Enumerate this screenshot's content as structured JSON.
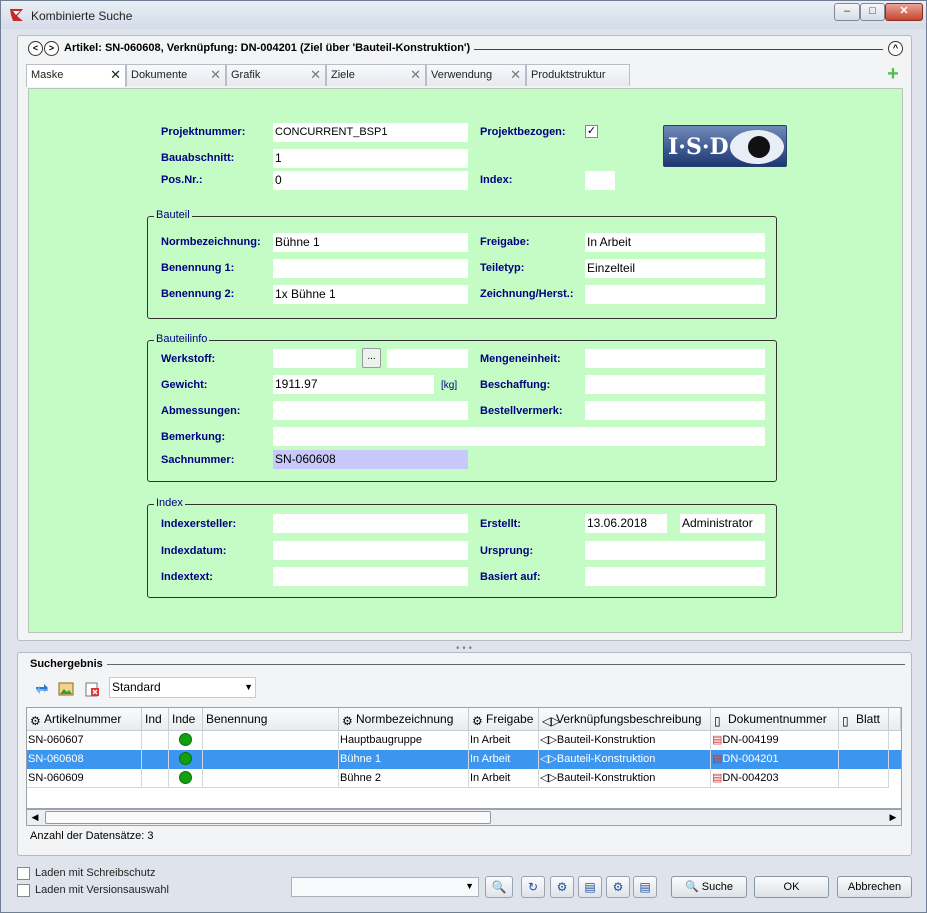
{
  "window": {
    "title": "Kombinierte Suche",
    "minimize": "‒",
    "maximize": "□",
    "close": "✕"
  },
  "header": {
    "back": "<",
    "forward": ">",
    "collapse": "^",
    "title": "Artikel: SN-060608, Verknüpfung: DN-004201 (Ziel über 'Bauteil-Konstruktion')"
  },
  "tabs": [
    {
      "label": "Maske",
      "close": "✕"
    },
    {
      "label": "Dokumente",
      "close": "✕"
    },
    {
      "label": "Grafik",
      "close": "✕"
    },
    {
      "label": "Ziele",
      "close": "✕"
    },
    {
      "label": "Verwendung",
      "close": "✕"
    },
    {
      "label": "Produktstruktur",
      "close": ""
    }
  ],
  "add_tab": "+",
  "form": {
    "projektnummer_label": "Projektnummer:",
    "projektnummer_value": "CONCURRENT_BSP1",
    "projektbezogen_label": "Projektbezogen:",
    "projektbezogen_check": "✓",
    "bauabschnitt_label": "Bauabschnitt:",
    "bauabschnitt_value": "1",
    "posnr_label": "Pos.Nr.:",
    "posnr_value": "0",
    "index_label": "Index:",
    "index_value": "",
    "logo_text": "I·S·D",
    "bauteil": {
      "title": "Bauteil",
      "normbezeichnung_label": "Normbezeichnung:",
      "normbezeichnung_value": "Bühne 1",
      "freigabe_label": "Freigabe:",
      "freigabe_value": "In Arbeit",
      "benennung1_label": "Benennung 1:",
      "benennung1_value": "",
      "teiletyp_label": "Teiletyp:",
      "teiletyp_value": "Einzelteil",
      "benennung2_label": "Benennung 2:",
      "benennung2_value": "1x Bühne 1",
      "zeichnung_label": "Zeichnung/Herst.:",
      "zeichnung_value": ""
    },
    "bauteilinfo": {
      "title": "Bauteilinfo",
      "werkstoff_label": "Werkstoff:",
      "werkstoff_value": "",
      "werkstoff_button": "...",
      "werkstoff_value2": "",
      "mengeneinheit_label": "Mengeneinheit:",
      "mengeneinheit_value": "",
      "gewicht_label": "Gewicht:",
      "gewicht_value": "1911.97",
      "gewicht_unit": "[kg]",
      "beschaffung_label": "Beschaffung:",
      "beschaffung_value": "",
      "abmessungen_label": "Abmessungen:",
      "abmessungen_value": "",
      "bestellvermerk_label": "Bestellvermerk:",
      "bestellvermerk_value": "",
      "bemerkung_label": "Bemerkung:",
      "bemerkung_value": "",
      "sachnummer_label": "Sachnummer:",
      "sachnummer_value": "SN-060608"
    },
    "index_group": {
      "title": "Index",
      "indexersteller_label": "Indexersteller:",
      "indexersteller_value": "",
      "erstellt_label": "Erstellt:",
      "erstellt_date": "13.06.2018",
      "erstellt_user": "Administrator",
      "indexdatum_label": "Indexdatum:",
      "indexdatum_value": "",
      "ursprung_label": "Ursprung:",
      "ursprung_value": "",
      "indextext_label": "Indextext:",
      "indextext_value": "",
      "basiert_label": "Basiert auf:",
      "basiert_value": ""
    }
  },
  "splitter": "• • •",
  "results": {
    "title": "Suchergebnis",
    "view_combo": "Standard",
    "columns": [
      "Artikelnummer",
      "Ind",
      "Inde",
      "Benennung",
      "Normbezeichnung",
      "Freigabe",
      "Verknüpfungsbeschreibung",
      "Dokumentnummer",
      "Blatt",
      ""
    ],
    "rows": [
      {
        "artikel": "SN-060607",
        "norm": "Hauptbaugruppe",
        "freigabe": "In Arbeit",
        "verkn": "Bauteil-Konstruktion",
        "dok": "DN-004199"
      },
      {
        "artikel": "SN-060608",
        "norm": "Bühne 1",
        "freigabe": "In Arbeit",
        "verkn": "Bauteil-Konstruktion",
        "dok": "DN-004201"
      },
      {
        "artikel": "SN-060609",
        "norm": "Bühne 2",
        "freigabe": "In Arbeit",
        "verkn": "Bauteil-Konstruktion",
        "dok": "DN-004203"
      }
    ],
    "selected_row": 1,
    "count_text": "Anzahl der Datensätze: 3"
  },
  "bottom": {
    "schreibschutz_label": "Laden mit Schreibschutz",
    "versionsauswahl_label": "Laden mit Versionsauswahl",
    "search_button": "Suche",
    "ok_button": "OK",
    "cancel_button": "Abbrechen"
  },
  "colors": {
    "form_bg": "#c5fcc6",
    "label_blue": "#000080",
    "selection": "#3c96f0",
    "readonly_field": "#c8c8fc"
  }
}
